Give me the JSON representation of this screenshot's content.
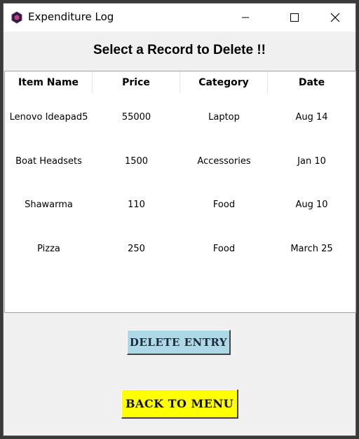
{
  "window": {
    "title": "Expenditure Log"
  },
  "heading": "Select a Record to Delete !!",
  "table": {
    "columns": [
      "Item Name",
      "Price",
      "Category",
      "Date"
    ],
    "rows": [
      [
        "Lenovo Ideapad5",
        "55000",
        "Laptop",
        "Aug 14"
      ],
      [
        "Boat Headsets",
        "1500",
        "Accessories",
        "Jan 10"
      ],
      [
        "Shawarma",
        "110",
        "Food",
        "Aug 10"
      ],
      [
        "Pizza",
        "250",
        "Food",
        "March 25"
      ]
    ]
  },
  "buttons": {
    "delete_label": "DELETE ENTRY",
    "back_label": "BACK TO MENU",
    "delete_color": "#add8e6",
    "back_color": "#ffff00"
  },
  "icons": [
    "app-icon",
    "minimize-icon",
    "maximize-icon",
    "close-icon"
  ]
}
